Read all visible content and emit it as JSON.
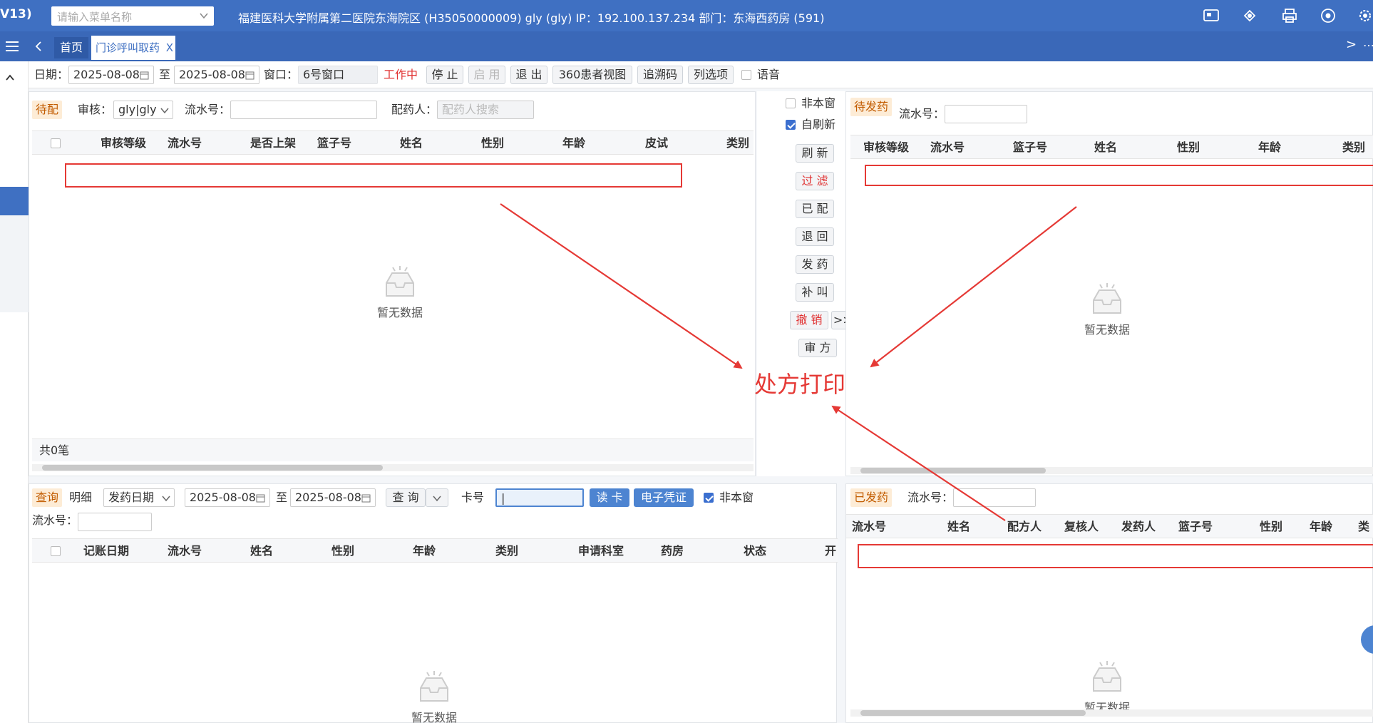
{
  "header": {
    "version": "V13)",
    "menu_search_placeholder": "请输入菜单名称",
    "info": "福建医科大学附属第二医院东海院区 (H35050000009) gly (gly) IP：192.100.137.234 部门：东海西药房 (591)"
  },
  "tabs": {
    "home": "首页",
    "active": "门诊呼叫取药",
    "close": "X",
    "next": ">",
    "more": "…"
  },
  "toolbar": {
    "date_label": "日期：",
    "date_from": "2025-08-08",
    "to": "至",
    "date_to": "2025-08-08",
    "window_label": "窗口：",
    "window_value": "6号窗口",
    "status": "工作中",
    "stop": "停 止",
    "start": "启 用",
    "exit": "退 出",
    "view360": "360患者视图",
    "trace_code": "追溯码",
    "columns": "列选项",
    "voice": "语音"
  },
  "pending": {
    "tag": "待配",
    "review_label": "审核：",
    "review_value": "gly|gly",
    "serial_label": "流水号：",
    "dispenser_label": "配药人：",
    "dispenser_placeholder": "配药人搜索",
    "columns": [
      "审核等级",
      "流水号",
      "是否上架",
      "篮子号",
      "姓名",
      "性别",
      "年龄",
      "皮试",
      "类别"
    ],
    "empty": "暂无数据",
    "total": "共0笔"
  },
  "middle": {
    "not_this_window": "非本窗",
    "auto_refresh": "自刷新",
    "refresh": "刷 新",
    "filter": "过 滤",
    "dispensed": "已 配",
    "return": "退 回",
    "issue": "发 药",
    "recall": "补 叫",
    "revoke": "撤 销",
    "more": ">>>",
    "review_rx": "审 方"
  },
  "annotation": {
    "text": "处方打印",
    "color": "#e53935"
  },
  "to_issue": {
    "tag": "待发药",
    "serial_label": "流水号：",
    "columns": [
      "审核等级",
      "流水号",
      "篮子号",
      "姓名",
      "性别",
      "年龄",
      "类别"
    ],
    "empty": "暂无数据"
  },
  "query": {
    "tag": "查询",
    "detail": "明细",
    "date_type": "发药日期",
    "date_from": "2025-08-08",
    "to": "至",
    "date_to": "2025-08-08",
    "query_btn": "查 询",
    "card_label": "卡号",
    "card_value": "|",
    "read_card": "读 卡",
    "e_voucher": "电子凭证",
    "not_this_window": "非本窗",
    "serial_label": "流水号：",
    "columns": [
      "记账日期",
      "流水号",
      "姓名",
      "性别",
      "年龄",
      "类别",
      "申请科室",
      "药房",
      "状态",
      "开"
    ],
    "empty": "暂无数据"
  },
  "issued": {
    "tag": "已发药",
    "serial_label": "流水号：",
    "columns": [
      "流水号",
      "姓名",
      "配方人",
      "复核人",
      "发药人",
      "篮子号",
      "性别",
      "年龄",
      "类"
    ],
    "empty": "暂无数据"
  },
  "colors": {
    "header_bg": "#3f70c2",
    "accent": "#4d84d1",
    "tag_bg": "#fdecd6",
    "danger": "#e53935"
  }
}
